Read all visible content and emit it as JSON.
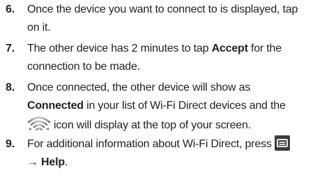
{
  "steps": [
    {
      "number": "6.",
      "line1": "Once the device you want to connect to is displayed, tap",
      "line2": "on it."
    },
    {
      "number": "7.",
      "line1_a": "The other device has 2 minutes to tap ",
      "line1_bold": "Accept",
      "line1_b": " for the",
      "line2": "connection to be made."
    },
    {
      "number": "8.",
      "line1": "Once connected, the other device will show as",
      "line2_bold": "Connected",
      "line2_b": " in your list of Wi-Fi Direct devices and the",
      "line3": "icon will display at the top of your screen.",
      "icon": "wifi-direct-icon"
    },
    {
      "number": "9.",
      "line1": "For additional information about Wi-Fi Direct, press",
      "icon": "menu-icon",
      "line2_bold": "→ Help",
      "line2_b": "."
    }
  ],
  "colors": {
    "text": "#231f20",
    "menu_icon_bg": "#3c3c3c",
    "wifi_icon": "#9a9a9a"
  }
}
